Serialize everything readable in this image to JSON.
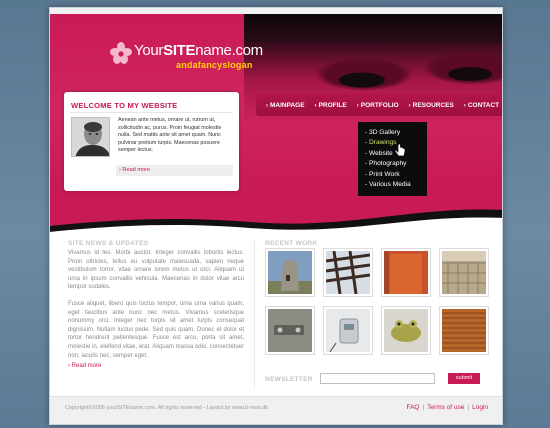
{
  "logo": {
    "name_prefix": "Your",
    "name_bold": "SITE",
    "name_suffix": "name.com",
    "slogan": "andafancyslogan"
  },
  "nav": {
    "items": [
      {
        "label": "MAINPAGE"
      },
      {
        "label": "PROFILE"
      },
      {
        "label": "PORTFOLIO"
      },
      {
        "label": "RESOURCES"
      },
      {
        "label": "CONTACT"
      }
    ],
    "arrow_glyph": "›"
  },
  "dropdown": {
    "items": [
      {
        "label": "- 3D Gallery"
      },
      {
        "label": "- Drawings"
      },
      {
        "label": "- Website"
      },
      {
        "label": "- Photography"
      },
      {
        "label": "- Print Work"
      },
      {
        "label": "- Various Media"
      }
    ],
    "active_index": 1
  },
  "welcome": {
    "title": "WELCOME TO MY WEBSITE",
    "text": "Aenean ante metus, ornare ut, rutrum ut, sollicitudin ac, purus. Proin feugiat molestie nulla. Sed mattis ante sit amet quam. Nunc pulvinar pretium turpis. Maecenas posuere semper lectus.",
    "read_more": "› Read more"
  },
  "news": {
    "title": "SITE NEWS & UPDATES",
    "paragraph_1": "Vivamus id leo. Morbi auctor. Integer convallis lobortis lectus. Proin ultricies, tellus eu vulputate malesuada, sapien neque vestibulum tortor, vitae ornare lorem metus ut orci. Aliquam ut urna in ipsum convallis vehicula. Maecenas in dolor vitae arcu tempor sodales.",
    "paragraph_2": "Fusce aliquet, libero quis luctus tempor, urna urna varius quam, eget faucibus ante nunc nec metus. Vivamus scelerisque nonummy orci. Integer nec turpis sit amet turpis consequat dignissim. Nullam luctus pede. Sed quis quam. Donec et dolor et tortor hendrerit pellentesque. Fusce est arcu, porta sit amet, molestie in, eleifend vitae, erat. Aliquam massa odio, consectetuer non, iaculis nec, semper eget.",
    "read_more": "› Read more"
  },
  "recent_work": {
    "title": "RECENT WORK",
    "thumbnails": [
      {
        "icon": "stone-tower-photo"
      },
      {
        "icon": "wooden-beams-photo"
      },
      {
        "icon": "orange-door-photo"
      },
      {
        "icon": "brick-pavement-photo"
      },
      {
        "icon": "metal-hinge-photo"
      },
      {
        "icon": "electric-meter-photo"
      },
      {
        "icon": "frog-figurine-photo"
      },
      {
        "icon": "window-blinds-photo"
      }
    ]
  },
  "newsletter": {
    "title": "NEWSLETTER",
    "input_value": "",
    "button_label": "submit"
  },
  "footer": {
    "copyright": "Copyright©2006 yourSITEname.com. All rights reserved - Layout by www.b-man.dk",
    "links": [
      {
        "label": "FAQ"
      },
      {
        "label": "Terms of use"
      },
      {
        "label": "Login"
      }
    ],
    "separator": "|"
  },
  "colors": {
    "brand": "#c81a55",
    "slogan": "#ffd200",
    "dropdown_active": "#c9e86d",
    "background": "#5f7d96"
  }
}
